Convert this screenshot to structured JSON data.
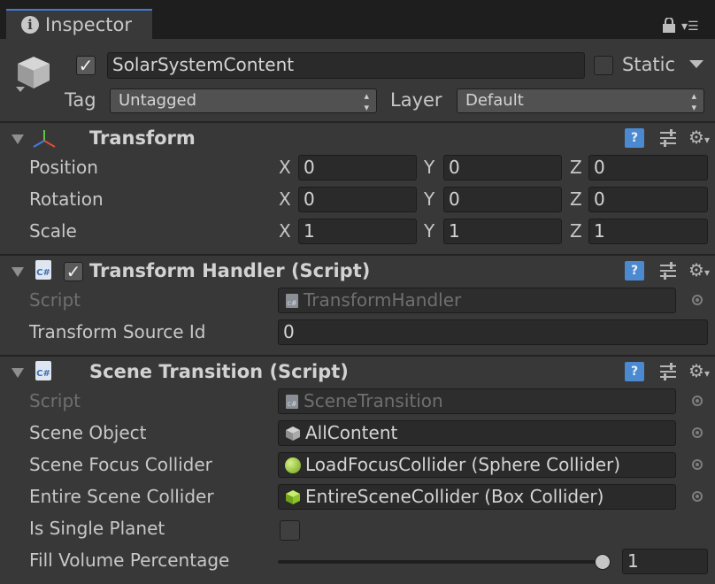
{
  "tab": {
    "label": "Inspector"
  },
  "gameobject": {
    "name": "SolarSystemContent",
    "static_label": "Static",
    "tag_label": "Tag",
    "tag_value": "Untagged",
    "layer_label": "Layer",
    "layer_value": "Default"
  },
  "transform": {
    "title": "Transform",
    "rows": [
      {
        "label": "Position",
        "x": "0",
        "y": "0",
        "z": "0"
      },
      {
        "label": "Rotation",
        "x": "0",
        "y": "0",
        "z": "0"
      },
      {
        "label": "Scale",
        "x": "1",
        "y": "1",
        "z": "1"
      }
    ],
    "axis": {
      "x": "X",
      "y": "Y",
      "z": "Z"
    }
  },
  "transform_handler": {
    "title": "Transform Handler (Script)",
    "script_label": "Script",
    "script_value": "TransformHandler",
    "source_label": "Transform Source Id",
    "source_value": "0"
  },
  "scene_transition": {
    "title": "Scene Transition (Script)",
    "script_label": "Script",
    "script_value": "SceneTransition",
    "scene_object_label": "Scene Object",
    "scene_object_value": "AllContent",
    "focus_label": "Scene Focus Collider",
    "focus_value": "LoadFocusCollider (Sphere Collider)",
    "entire_label": "Entire Scene Collider",
    "entire_value": "EntireSceneCollider (Box Collider)",
    "single_label": "Is Single Planet",
    "fill_label": "Fill Volume Percentage",
    "fill_value": "1",
    "fill_fraction": 1
  },
  "icons": {
    "cs": "C#",
    "help": "?",
    "gear": "⚙",
    "check": "✓"
  }
}
